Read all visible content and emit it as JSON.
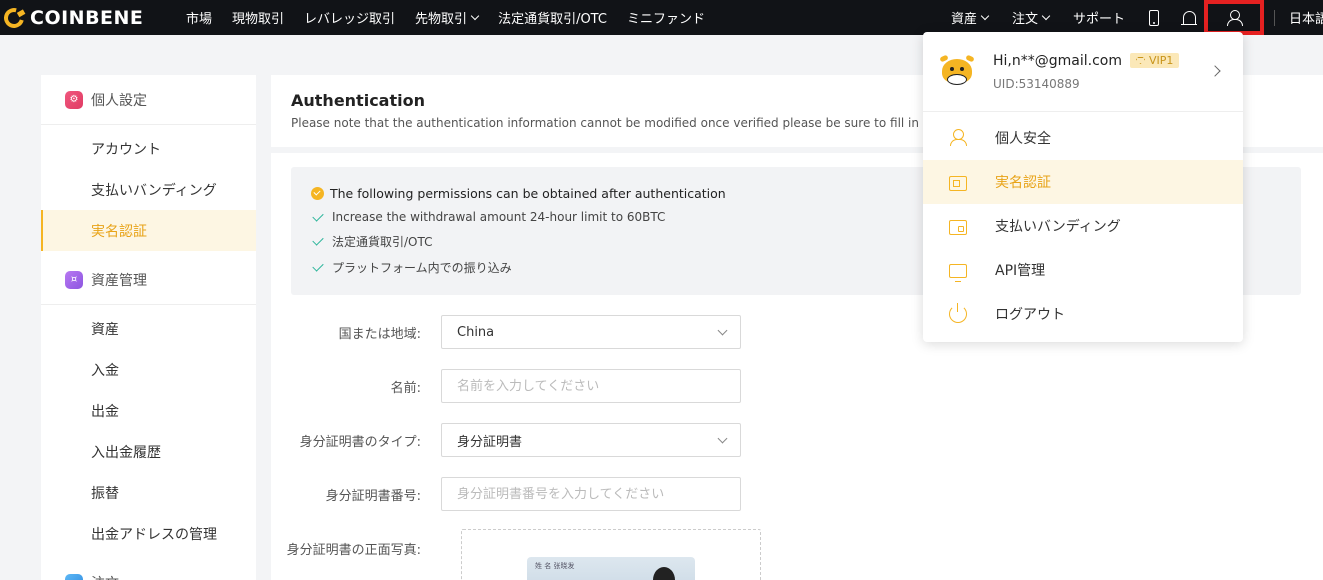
{
  "nav": {
    "brand": "COINBENE",
    "links": [
      "市場",
      "現物取引",
      "レバレッジ取引",
      "先物取引",
      "法定通貨取引/OTC",
      "ミニファンド"
    ],
    "right": {
      "assets": "資産",
      "orders": "注文",
      "support": "サポート",
      "language": "日本語"
    }
  },
  "sidebar": {
    "sections": [
      {
        "title": "個人設定",
        "items": [
          "アカウント",
          "支払いバンディング",
          "実名認証"
        ]
      },
      {
        "title": "資産管理",
        "items": [
          "資産",
          "入金",
          "出金",
          "入出金履歴",
          "振替",
          "出金アドレスの管理"
        ]
      },
      {
        "title": "注文"
      }
    ],
    "active_item": "実名認証"
  },
  "main": {
    "title": "Authentication",
    "subtitle": "Please note that the authentication information cannot be modified once verified please be sure to fill in the a",
    "permissions_title": "The following permissions can be obtained after authentication",
    "permissions": [
      "Increase the withdrawal amount 24-hour limit to 60BTC",
      "法定通貨取引/OTC",
      "プラットフォーム内での振り込み"
    ],
    "form": {
      "country_label": "国または地域:",
      "country_value": "China",
      "name_label": "名前:",
      "name_placeholder": "名前を入力してください",
      "id_type_label": "身分証明書のタイプ:",
      "id_type_value": "身分証明書",
      "id_number_label": "身分証明書番号:",
      "id_number_placeholder": "身分証明書番号を入力してください",
      "id_front_label": "身分証明書の正面写真:",
      "id_sample_text": "姓 名  张晓发"
    }
  },
  "user_menu": {
    "email": "Hi,n**@gmail.com",
    "vip": "VIP1",
    "uid": "UID:53140889",
    "items": [
      "個人安全",
      "実名認証",
      "支払いバンディング",
      "API管理",
      "ログアウト"
    ],
    "active_item": "実名認証"
  },
  "colors": {
    "accent": "#f5b523",
    "nav_bg": "#111317",
    "active_bg": "#fdf6e3",
    "check": "#2bb59a",
    "highlight_box": "#e52121"
  }
}
